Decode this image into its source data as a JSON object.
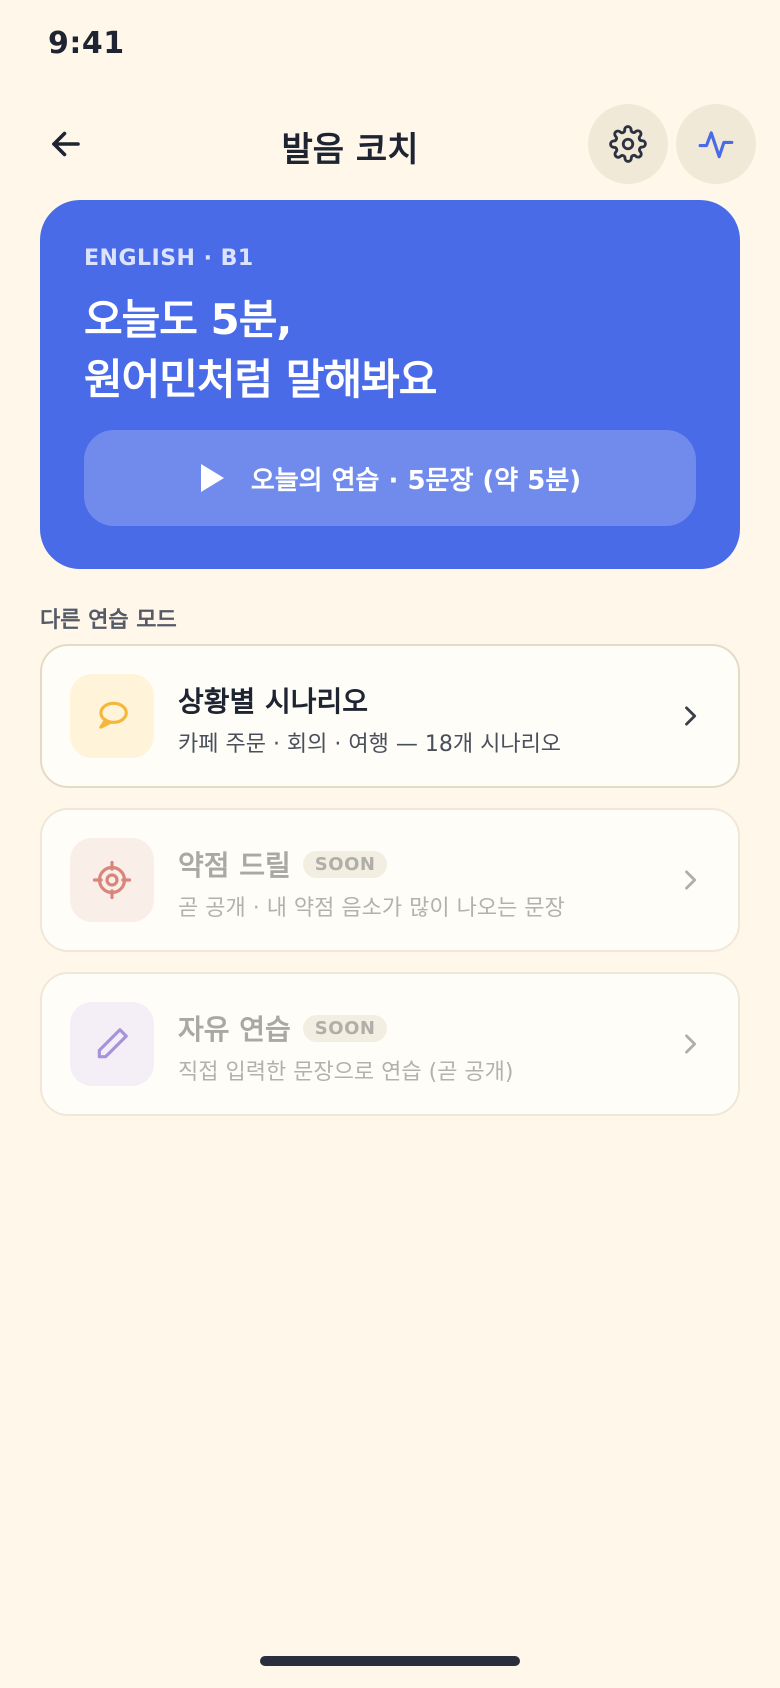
{
  "status_bar": {
    "time": "9:41"
  },
  "header": {
    "title": "발음 코치",
    "back_icon": "arrow-left-icon",
    "settings_icon": "gear-icon",
    "activity_icon": "activity-pulse-icon"
  },
  "hero": {
    "level": "ENGLISH · B1",
    "headline_line1": "오늘도 5분,",
    "headline_line2": "원어민처럼 말해봐요",
    "cta_label": "오늘의 연습 · 5문장 (약 5분)",
    "cta_icon": "play-icon"
  },
  "section_title": "다른 연습 모드",
  "modes": [
    {
      "title": "상황별 시나리오",
      "subtitle": "카페 주문 · 회의 · 여행 — 18개 시나리오",
      "badge": "",
      "icon": "chat-bubble-icon",
      "enabled": true
    },
    {
      "title": "약점 드릴",
      "subtitle": "곧 공개 · 내 약점 음소가 많이 나오는 문장",
      "badge": "SOON",
      "icon": "target-icon",
      "enabled": false
    },
    {
      "title": "자유 연습",
      "subtitle": "직접 입력한 문장으로 연습 (곧 공개)",
      "badge": "SOON",
      "icon": "pencil-icon",
      "enabled": false
    }
  ],
  "colors": {
    "background": "#FFF8EA",
    "primary": "#4A6BE8",
    "text": "#1F2433",
    "scenario_accent": "#F4B73B",
    "drill_accent": "#D9857A",
    "free_accent": "#A793DC"
  }
}
